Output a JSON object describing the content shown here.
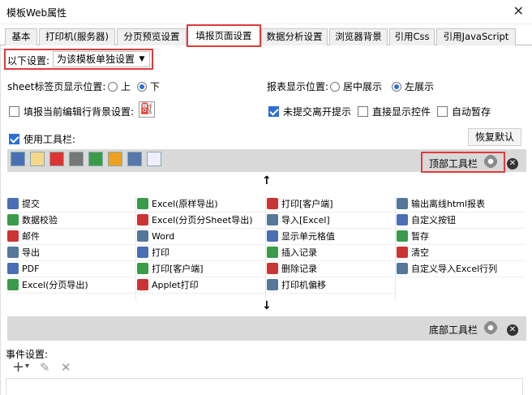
{
  "window": {
    "title": "模板Web属性",
    "close_glyph": "✕"
  },
  "tabs": [
    {
      "label": "基本"
    },
    {
      "label": "打印机(服务器)"
    },
    {
      "label": "分页预览设置"
    },
    {
      "label": "填报页面设置"
    },
    {
      "label": "数据分析设置"
    },
    {
      "label": "浏览器背景"
    },
    {
      "label": "引用Css"
    },
    {
      "label": "引用JavaScript"
    }
  ],
  "settings": {
    "following_label": "以下设置:",
    "following_value": "为该模板单独设置",
    "sheet_tab_label": "sheet标签页显示位置:",
    "sheet_tab_options": [
      "上",
      "下"
    ],
    "report_pos_label": "报表显示位置:",
    "report_pos_options": [
      "居中展示",
      "左展示"
    ],
    "fill_bg_label": "填报当前编辑行背景设置:",
    "unsubmitted_label": "未提交离开提示",
    "direct_control_label": "直接显示控件",
    "auto_save_label": "自动暂存",
    "use_toolbar_label": "使用工具栏:",
    "restore_default": "恢复默认"
  },
  "toolbar": {
    "top_label": "顶部工具栏",
    "bottom_label": "底部工具栏",
    "up_arrow": "↑",
    "down_arrow": "↓",
    "close_glyph": "✕"
  },
  "buttons_grid": [
    [
      "提交",
      "Excel(原样导出)",
      "打印[客户端]",
      "输出离线html报表"
    ],
    [
      "数据校验",
      "Excel(分页分Sheet导出)",
      "导入[Excel]",
      "自定义按钮"
    ],
    [
      "邮件",
      "Word",
      "显示单元格值",
      "暂存"
    ],
    [
      "导出",
      "打印",
      "插入记录",
      "清空"
    ],
    [
      "PDF",
      "打印[客户端]",
      "删除记录",
      "自定义导入Excel行列"
    ],
    [
      "Excel(分页导出)",
      "Applet打印",
      "打印机偏移",
      ""
    ]
  ],
  "events": {
    "label": "事件设置:",
    "add_glyph": "+",
    "dropdown_glyph": "▾",
    "edit_glyph": "✎",
    "delete_glyph": "✕"
  },
  "colors": {
    "accent": "#2b6ed8",
    "highlight": "#e03c3c",
    "bar": "#d9d9d9"
  }
}
